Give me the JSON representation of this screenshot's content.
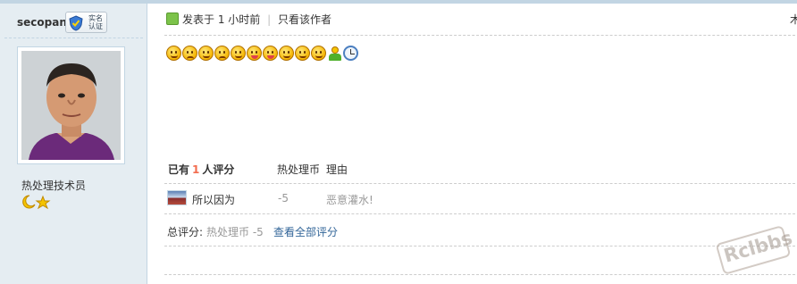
{
  "author": {
    "username": "secopan",
    "verified_badge": "实名认证",
    "title": "热处理技术员"
  },
  "post_header": {
    "posted_label": "发表于",
    "time_ago": "1 小时前",
    "author_only_link": "只看该作者",
    "truncated_right": "木"
  },
  "emoji_icons": [
    "smile",
    "sad",
    "grin",
    "cry",
    "dizzy",
    "tongue",
    "tongue-wink",
    "shy",
    "sweat",
    "laugh",
    "person",
    "clock"
  ],
  "rating": {
    "header_prefix": "已有",
    "header_count": "1",
    "header_suffix": "人评分",
    "currency_col": "热处理币",
    "reason_col": "理由",
    "rows": [
      {
        "rater": "所以因为",
        "score": "-5",
        "reason": "恶意灌水!"
      }
    ],
    "total_label": "总评分:",
    "total_value": "热处理币 -5",
    "view_all_link": "查看全部评分"
  },
  "watermark_text": "Rclbbs",
  "colors": {
    "sidebar_bg": "#e5edf2",
    "border": "#c2d5e3",
    "link": "#336699",
    "highlight_number": "#f26c4f",
    "muted": "#999999"
  }
}
